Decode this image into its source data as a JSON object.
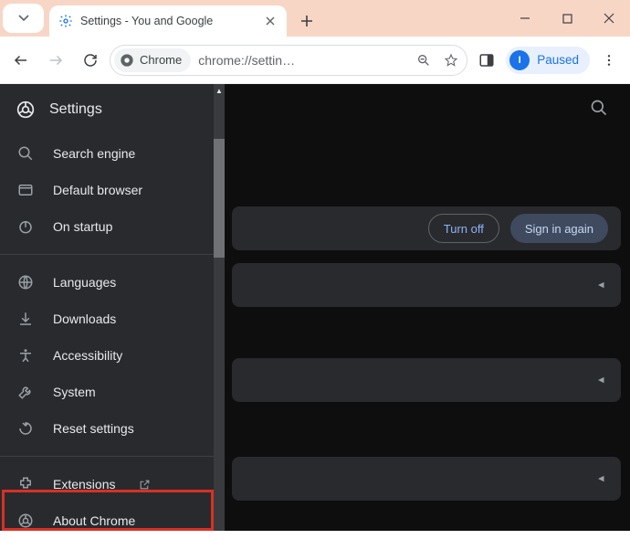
{
  "tab": {
    "title": "Settings - You and Google"
  },
  "omnibox": {
    "site_label": "Chrome",
    "url": "chrome://settin…"
  },
  "profile": {
    "status": "Paused",
    "initial": "I"
  },
  "settings_header": {
    "title": "Settings"
  },
  "sidebar": {
    "items": [
      {
        "label": "Search engine"
      },
      {
        "label": "Default browser"
      },
      {
        "label": "On startup"
      }
    ],
    "group2": [
      {
        "label": "Languages"
      },
      {
        "label": "Downloads"
      },
      {
        "label": "Accessibility"
      },
      {
        "label": "System"
      },
      {
        "label": "Reset settings"
      }
    ],
    "group3": [
      {
        "label": "Extensions"
      },
      {
        "label": "About Chrome"
      }
    ]
  },
  "actions": {
    "turn_off": "Turn off",
    "sign_in_again": "Sign in again"
  }
}
